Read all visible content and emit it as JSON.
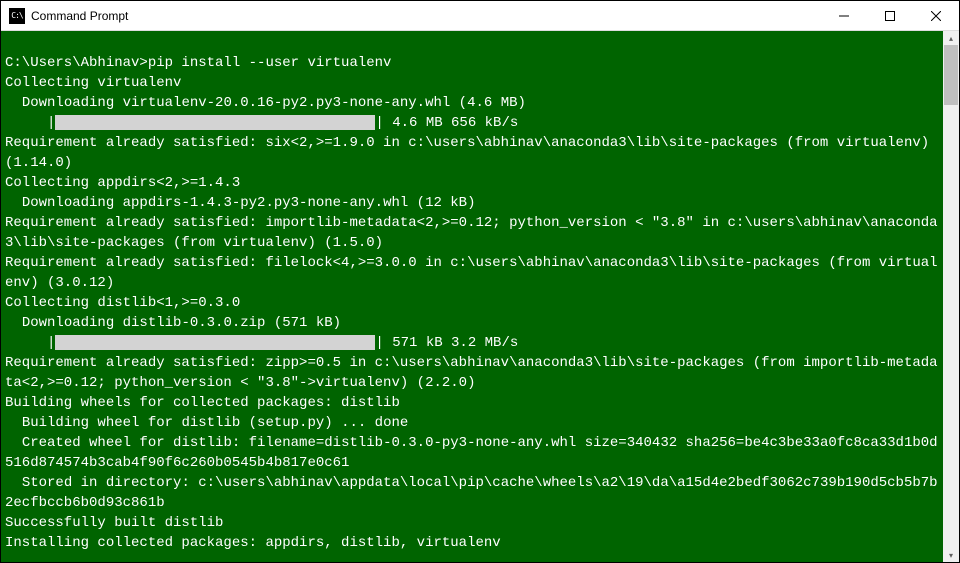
{
  "window": {
    "title": "Command Prompt"
  },
  "terminal": {
    "blank0": " ",
    "prompt_line": "C:\\Users\\Abhinav>pip install --user virtualenv",
    "line1": "Collecting virtualenv",
    "line2": "  Downloading virtualenv-20.0.16-py2.py3-none-any.whl (4.6 MB)",
    "progress1_prefix": "     |",
    "progress1_suffix": "| 4.6 MB 656 kB/s",
    "line4": "Requirement already satisfied: six<2,>=1.9.0 in c:\\users\\abhinav\\anaconda3\\lib\\site-packages (from virtualenv) (1.14.0)",
    "line5": "Collecting appdirs<2,>=1.4.3",
    "line6": "  Downloading appdirs-1.4.3-py2.py3-none-any.whl (12 kB)",
    "line7": "Requirement already satisfied: importlib-metadata<2,>=0.12; python_version < \"3.8\" in c:\\users\\abhinav\\anaconda3\\lib\\site-packages (from virtualenv) (1.5.0)",
    "line8": "Requirement already satisfied: filelock<4,>=3.0.0 in c:\\users\\abhinav\\anaconda3\\lib\\site-packages (from virtualenv) (3.0.12)",
    "line9": "Collecting distlib<1,>=0.3.0",
    "line10": "  Downloading distlib-0.3.0.zip (571 kB)",
    "progress2_prefix": "     |",
    "progress2_suffix": "| 571 kB 3.2 MB/s",
    "line12": "Requirement already satisfied: zipp>=0.5 in c:\\users\\abhinav\\anaconda3\\lib\\site-packages (from importlib-metadata<2,>=0.12; python_version < \"3.8\"->virtualenv) (2.2.0)",
    "line13": "Building wheels for collected packages: distlib",
    "line14": "  Building wheel for distlib (setup.py) ... done",
    "line15": "  Created wheel for distlib: filename=distlib-0.3.0-py3-none-any.whl size=340432 sha256=be4c3be33a0fc8ca33d1b0d516d874574b3cab4f90f6c260b0545b4b817e0c61",
    "line16": "  Stored in directory: c:\\users\\abhinav\\appdata\\local\\pip\\cache\\wheels\\a2\\19\\da\\a15d4e2bedf3062c739b190d5cb5b7b2ecfbccb6b0d93c861b",
    "line17": "Successfully built distlib",
    "line18": "Installing collected packages: appdirs, distlib, virtualenv"
  }
}
